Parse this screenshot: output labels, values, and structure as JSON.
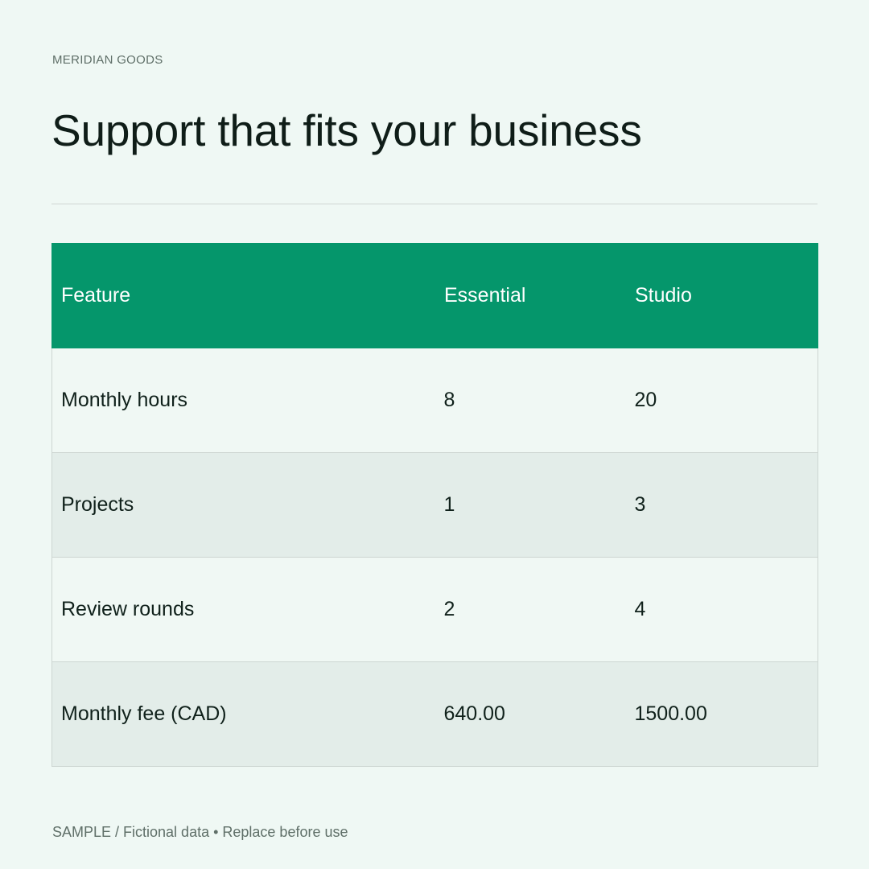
{
  "brand": "MERIDIAN GOODS",
  "title": "Support that fits your business",
  "table": {
    "headers": [
      "Feature",
      "Essential",
      "Studio"
    ],
    "rows": [
      [
        "Monthly hours",
        "8",
        "20"
      ],
      [
        "Projects",
        "1",
        "3"
      ],
      [
        "Review rounds",
        "2",
        "4"
      ],
      [
        "Monthly fee (CAD)",
        "640.00",
        "1500.00"
      ]
    ]
  },
  "footer": "SAMPLE / Fictional data • Replace before use",
  "colors": {
    "background": "#eff8f4",
    "header_accent": "#05966b",
    "row_alt": "#e3ede9",
    "text": "#10211b",
    "muted_text": "#5f6f68"
  }
}
